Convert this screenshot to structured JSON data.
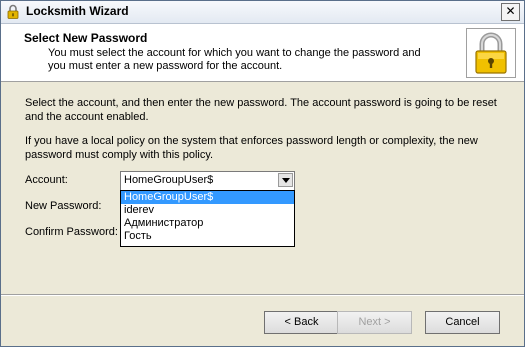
{
  "window": {
    "title": "Locksmith Wizard",
    "close_glyph": "✕",
    "title_icon": "lock-icon"
  },
  "header": {
    "title": "Select New Password",
    "description": "You must select the account for which you want to change the password and you must enter a new password for the account.",
    "icon": "padlock-icon"
  },
  "body": {
    "paragraph1": "Select the account, and then enter the new password. The account password is going to be reset and the account enabled.",
    "paragraph2": "If you have a local policy on the system that enforces password length or complexity, the new password must comply with this policy.",
    "account_label": "Account:",
    "account_selected": "HomeGroupUser$",
    "account_options": [
      "HomeGroupUser$",
      "iderev",
      "Администратор",
      "Гость"
    ],
    "new_password_label": "New Password:",
    "confirm_password_label": "Confirm Password:"
  },
  "footer": {
    "back_label": "< Back",
    "next_label": "Next >",
    "cancel_label": "Cancel"
  },
  "colors": {
    "selection": "#3399ff",
    "dialog_background": "#ece9d8"
  }
}
